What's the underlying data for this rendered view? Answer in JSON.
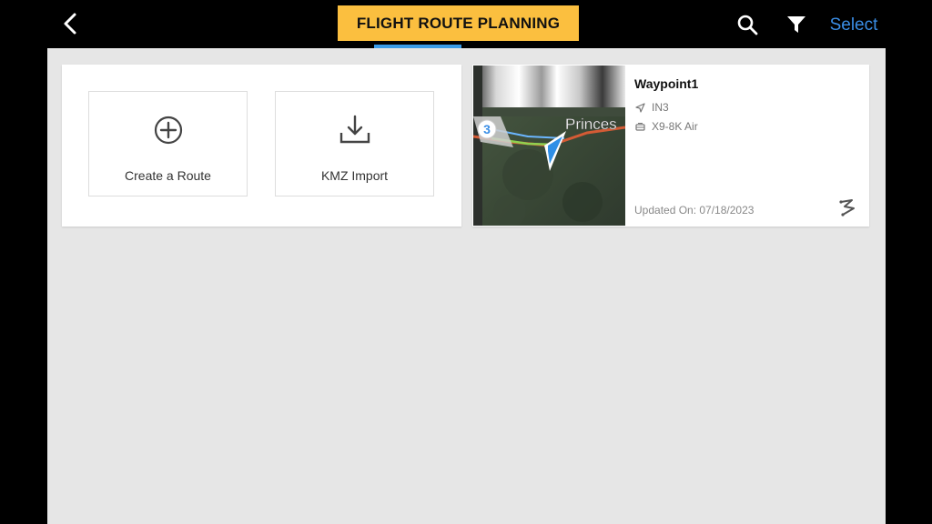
{
  "header": {
    "title": "FLIGHT ROUTE PLANNING",
    "select_label": "Select",
    "icons": [
      "back-arrow-icon",
      "search-icon",
      "filter-icon"
    ],
    "accent_color": "#fbbf3f",
    "tab_indicator_color": "#3a9be8",
    "select_color": "#3a8ee6"
  },
  "actions": {
    "create_label": "Create a Route",
    "create_icon": "plus-circle-icon",
    "kmz_label": "KMZ Import",
    "kmz_icon": "download-icon"
  },
  "routes": [
    {
      "name": "Waypoint1",
      "mission": "IN3",
      "aircraft": "X9-8K Air",
      "updated": "Updated On: 07/18/2023",
      "thumbnail": {
        "waypoint_count": "3",
        "map_text": "Princes"
      },
      "type_icon": "waypoint-route-icon"
    }
  ]
}
